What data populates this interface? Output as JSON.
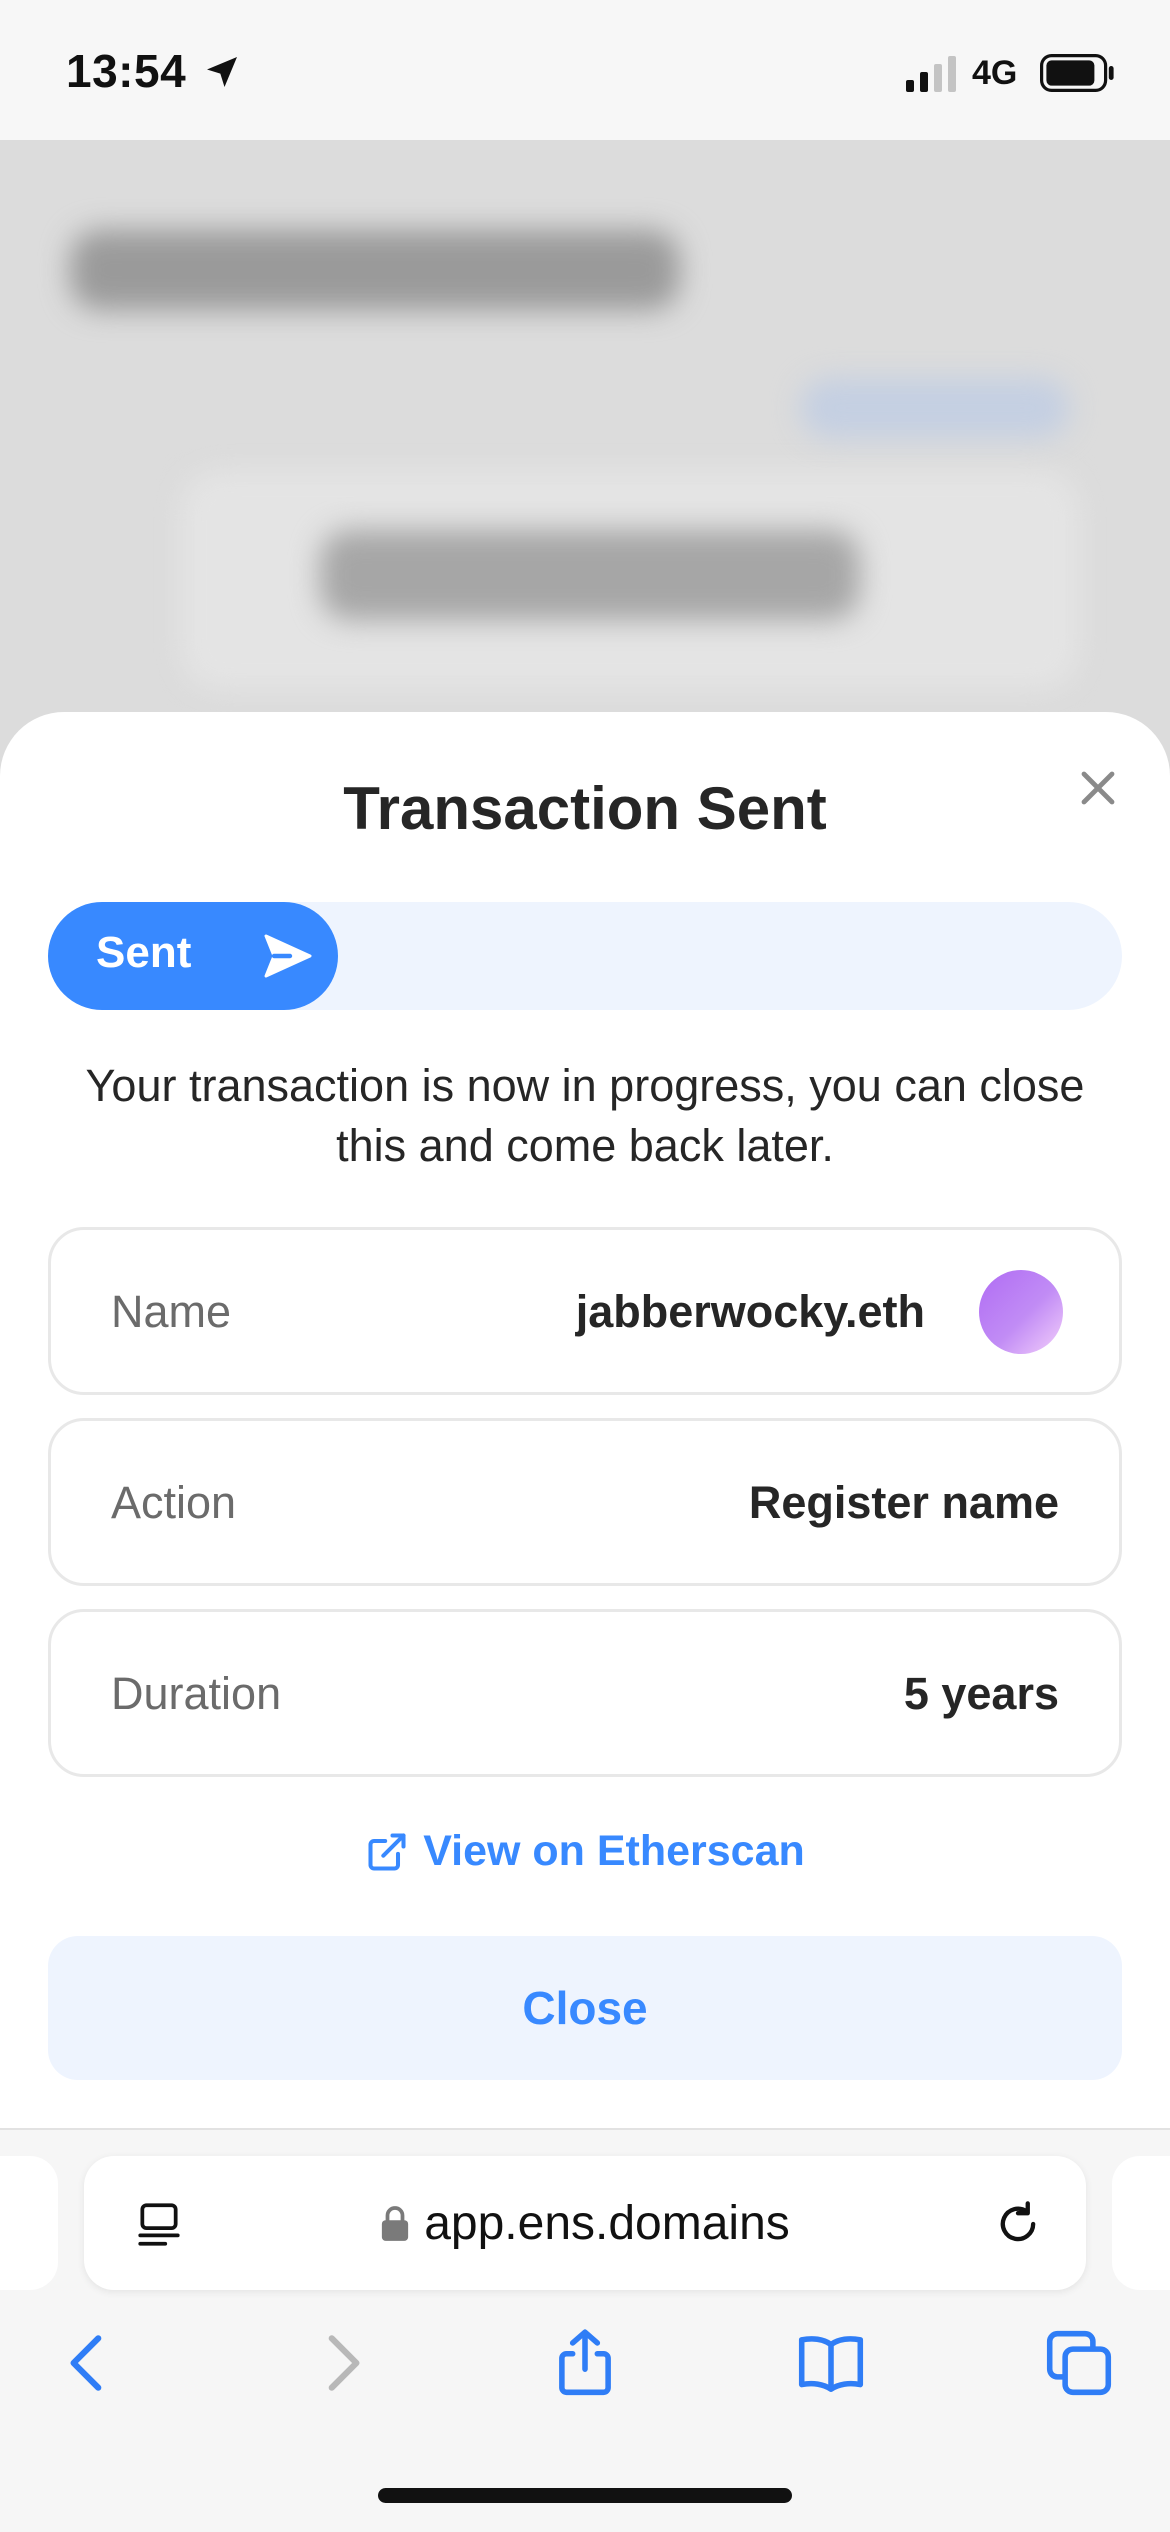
{
  "status_bar": {
    "time": "13:54",
    "network": "4G",
    "icons": [
      "location-arrow-icon",
      "signal-icon",
      "battery-icon"
    ]
  },
  "modal": {
    "title": "Transaction Sent",
    "close_icon": "close-icon",
    "progress": {
      "label": "Sent",
      "icon": "send-icon",
      "fraction": 0.27,
      "fill_color": "#3889ff",
      "track_color": "#eef4fe"
    },
    "description": "Your transaction is now in progress, you can close this and come back later.",
    "details": [
      {
        "label": "Name",
        "value": "jabberwocky.eth"
      },
      {
        "label": "Action",
        "value": "Register name"
      },
      {
        "label": "Duration",
        "value": "5 years"
      }
    ],
    "etherscan_link": "View on Etherscan",
    "close_button": "Close"
  },
  "browser": {
    "url": "app.ens.domains",
    "icons": [
      "reader-icon",
      "lock-icon",
      "reload-icon",
      "back-icon",
      "forward-icon",
      "share-icon",
      "bookmarks-icon",
      "tabs-icon"
    ]
  },
  "colors": {
    "accent": "#3889ff",
    "accent_light": "#eef4fe",
    "text": "#262626",
    "muted": "#6b6b6b"
  }
}
